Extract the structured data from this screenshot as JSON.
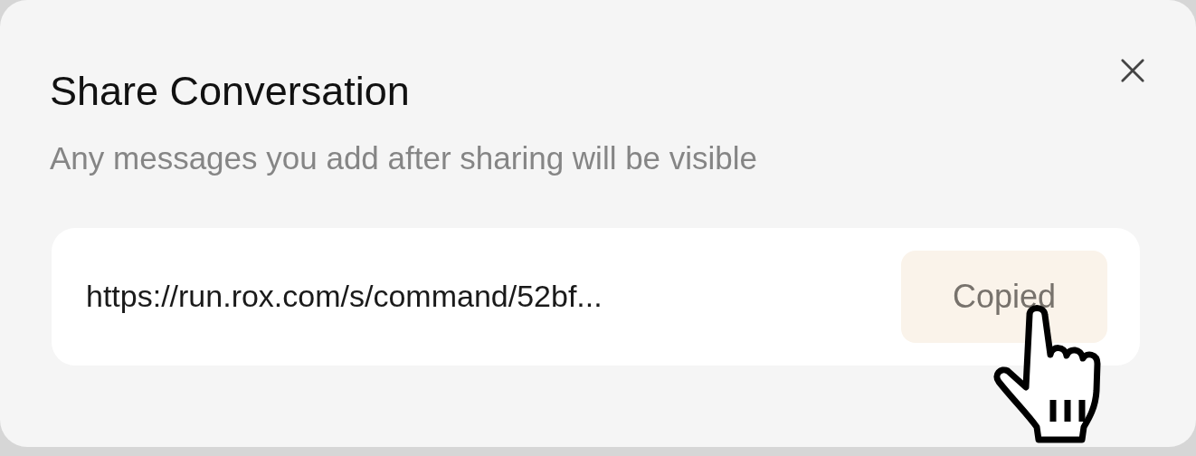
{
  "dialog": {
    "title": "Share Conversation",
    "description": "Any messages you add after sharing will be visible",
    "share_link": {
      "url": "https://run.rox.com/s/command/52bf...",
      "button": {
        "label": "Copied"
      }
    }
  }
}
